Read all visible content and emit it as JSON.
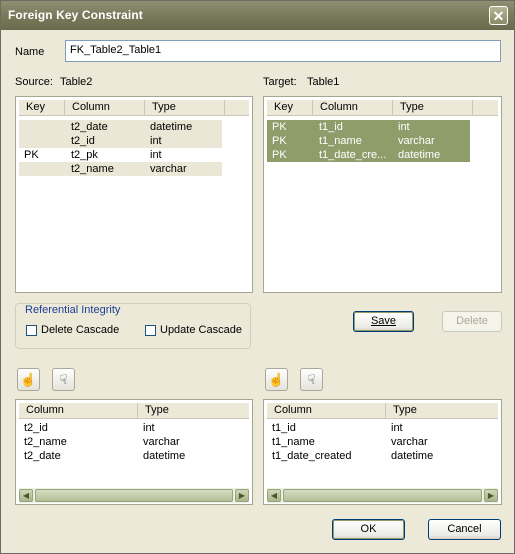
{
  "window": {
    "title": "Foreign Key Constraint",
    "close_glyph": "✕"
  },
  "name": {
    "label": "Name",
    "value": "FK_Table2_Table1"
  },
  "source": {
    "label": "Source:",
    "table": "Table2",
    "headers": [
      "Key",
      "Column",
      "Type"
    ],
    "rows": [
      {
        "key": "",
        "column": "t2_date",
        "type": "datetime"
      },
      {
        "key": "",
        "column": "t2_id",
        "type": "int"
      },
      {
        "key": "PK",
        "column": "t2_pk",
        "type": "int"
      },
      {
        "key": "",
        "column": "t2_name",
        "type": "varchar"
      }
    ]
  },
  "target": {
    "label": "Target:",
    "table": "Table1",
    "headers": [
      "Key",
      "Column",
      "Type"
    ],
    "rows": [
      {
        "key": "PK",
        "column": "t1_id",
        "type": "int"
      },
      {
        "key": "PK",
        "column": "t1_name",
        "type": "varchar"
      },
      {
        "key": "PK",
        "column": "t1_date_cre...",
        "type": "datetime"
      }
    ]
  },
  "referential": {
    "legend": "Referential Integrity",
    "delete_cascade": {
      "label": "Delete Cascade",
      "checked": false
    },
    "update_cascade": {
      "label": "Update Cascade",
      "checked": false
    }
  },
  "buttons": {
    "save": "Save",
    "delete": "Delete",
    "ok": "OK",
    "cancel": "Cancel"
  },
  "icons": {
    "move_up": "pointing-hand-up-icon",
    "move_down": "pointing-hand-down-icon"
  },
  "source_columns": {
    "headers": [
      "Column",
      "Type"
    ],
    "rows": [
      {
        "column": "t2_id",
        "type": "int"
      },
      {
        "column": "t2_name",
        "type": "varchar"
      },
      {
        "column": "t2_date",
        "type": "datetime"
      }
    ]
  },
  "target_columns": {
    "headers": [
      "Column",
      "Type"
    ],
    "rows": [
      {
        "column": "t1_id",
        "type": "int"
      },
      {
        "column": "t1_name",
        "type": "varchar"
      },
      {
        "column": "t1_date_created",
        "type": "datetime"
      }
    ]
  },
  "colors": {
    "title_bar": "#7b7b5d",
    "selected_row": "#8f9d6b",
    "row_tint": "#ebe7d6",
    "accent_blue": "#1c3f95"
  }
}
